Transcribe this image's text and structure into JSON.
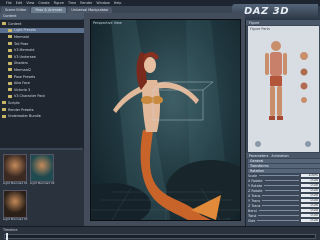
{
  "menubar": {
    "items": [
      "File",
      "Edit",
      "View",
      "Create",
      "Figure",
      "Time",
      "Render",
      "Window",
      "Help"
    ]
  },
  "tabs": [
    {
      "label": "Scene Editor",
      "active": false
    },
    {
      "label": "Pose & Animate",
      "active": true
    },
    {
      "label": "Universal Manipulator",
      "active": false
    }
  ],
  "logo": {
    "text": "DAZ 3D"
  },
  "left_panel": {
    "title": "Content",
    "tree": [
      {
        "label": "Content",
        "selected": false
      },
      {
        "label": "Light Presets",
        "selected": true
      },
      {
        "label": "Mermaid",
        "selected": false
      },
      {
        "label": "Tail Pose",
        "selected": false
      },
      {
        "label": "V3 Mermaid",
        "selected": false
      },
      {
        "label": "V3 Undersea",
        "selected": false
      },
      {
        "label": "Shaders",
        "selected": false
      },
      {
        "label": "Mermaid2",
        "selected": false
      },
      {
        "label": "Pose Presets",
        "selected": false
      },
      {
        "label": "Aiko Face",
        "selected": false
      },
      {
        "label": "Victoria 3",
        "selected": false
      },
      {
        "label": "V3 Character Pack",
        "selected": false
      },
      {
        "label": "Scripts",
        "selected": false
      },
      {
        "label": "Render Presets",
        "selected": false
      },
      {
        "label": "Underwater Bundle",
        "selected": false
      }
    ],
    "thumbnails": [
      {
        "label": "Light Mermaid 01"
      },
      {
        "label": "Light Mermaid 02"
      },
      {
        "label": "Light Mermaid 03"
      }
    ]
  },
  "viewport": {
    "label": "Perspective View",
    "colors": {
      "water": "#2c4a52",
      "hair": "#7a2a1c",
      "tail": "#d4702a"
    }
  },
  "right_panel": {
    "header": "Figure",
    "figure_label": "Figure Parts",
    "params_header": "Parameters",
    "params_tab2": "Animation",
    "sections": [
      "General",
      "Transforms",
      "Rotation"
    ],
    "params": [
      {
        "name": "Scale",
        "value": "100%"
      },
      {
        "name": "X Rotate",
        "value": "0.00"
      },
      {
        "name": "Y Rotate",
        "value": "0.00"
      },
      {
        "name": "Z Rotate",
        "value": "0.00"
      },
      {
        "name": "X Trans",
        "value": "0.00"
      },
      {
        "name": "Y Trans",
        "value": "0.00"
      },
      {
        "name": "Z Trans",
        "value": "0.00"
      },
      {
        "name": "Bend",
        "value": "0.00"
      },
      {
        "name": "Twist",
        "value": "0.00"
      },
      {
        "name": "Side",
        "value": "0.00"
      }
    ]
  },
  "timeline": {
    "label": "Timeline",
    "frame": "0"
  }
}
